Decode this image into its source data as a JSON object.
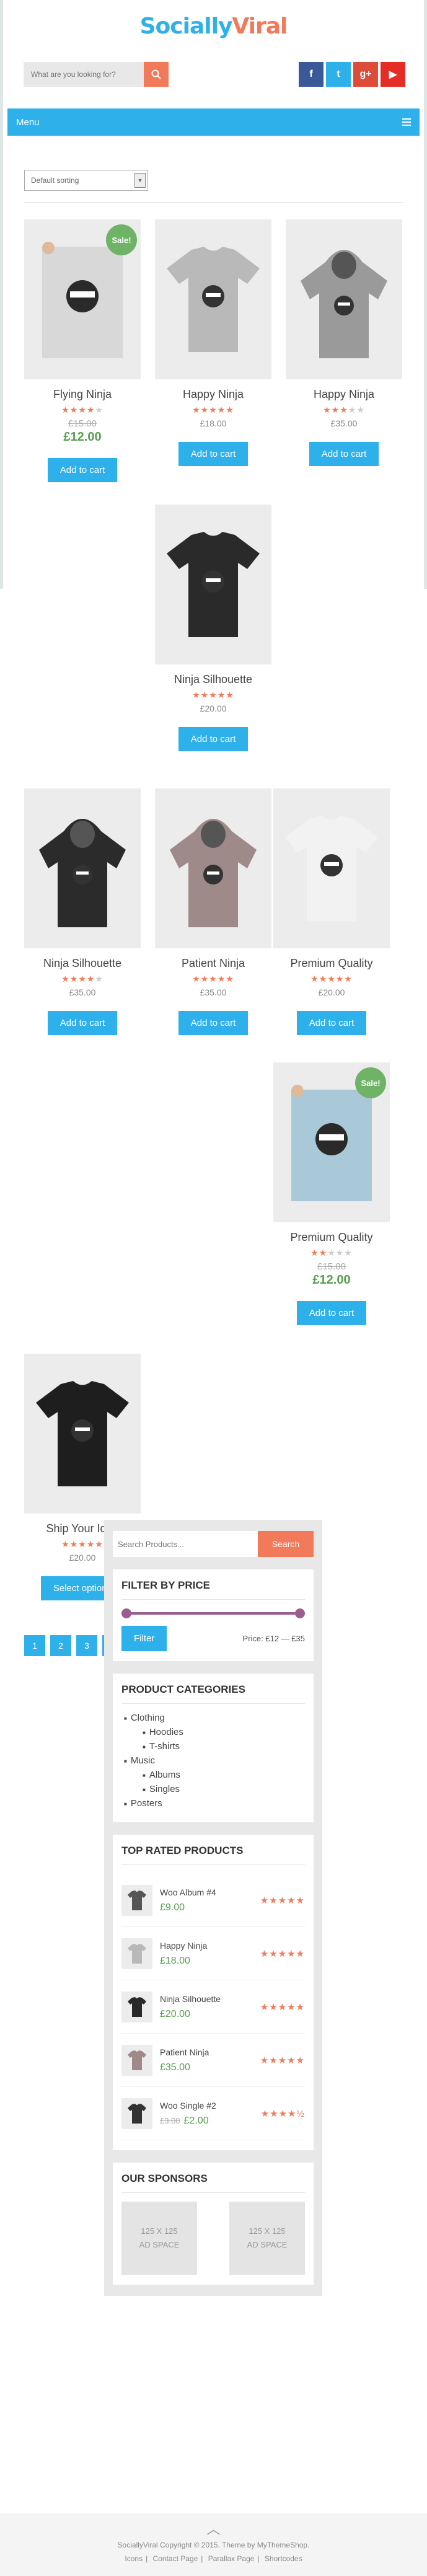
{
  "brand": {
    "part1": "Socially",
    "part2": "Viral"
  },
  "search": {
    "placeholder": "What are you looking for?"
  },
  "social": [
    "f",
    "t",
    "g+",
    "▶"
  ],
  "menu": {
    "label": "Menu"
  },
  "sorting": {
    "selected": "Default sorting"
  },
  "products": [
    {
      "name": "Flying Ninja",
      "rating": 4,
      "price_old": "£15.00",
      "price": "£12.00",
      "sale": "Sale!",
      "button": "Add to cart",
      "thumb": "poster"
    },
    {
      "name": "Happy Ninja",
      "rating": 5,
      "price": "£18.00",
      "button": "Add to cart",
      "thumb": "tshirt-grey"
    },
    {
      "name": "Happy Ninja",
      "rating": 3,
      "price": "£35.00",
      "button": "Add to cart",
      "thumb": "hoodie-grey"
    },
    {
      "name": "Ninja Silhouette",
      "rating": 5,
      "price": "£20.00",
      "button": "Add to cart",
      "thumb": "tshirt-black"
    },
    {
      "name": "Ninja Silhouette",
      "rating": 4,
      "price": "£35.00",
      "button": "Add to cart",
      "thumb": "hoodie-black"
    },
    {
      "name": "Patient Ninja",
      "rating": 5,
      "price": "£35.00",
      "button": "Add to cart",
      "thumb": "hoodie-pink"
    },
    {
      "name": "Premium Quality",
      "rating": 4.5,
      "price": "£20.00",
      "button": "Add to cart",
      "thumb": "tshirt-white"
    },
    {
      "name": "Premium Quality",
      "rating": 2,
      "price_old": "£15.00",
      "price": "£12.00",
      "sale": "Sale!",
      "button": "Add to cart",
      "thumb": "poster-blue"
    },
    {
      "name": "Ship Your Idea",
      "rating": 4.5,
      "price": "£20.00",
      "button": "Select options",
      "thumb": "tshirt-skull"
    }
  ],
  "pagination": [
    "1",
    "2",
    "3",
    "→"
  ],
  "sidebar": {
    "search_placeholder": "Search Products...",
    "search_button": "Search",
    "filter": {
      "title": "FILTER BY PRICE",
      "button": "Filter",
      "range_label": "Price: £12 — £35"
    },
    "categories": {
      "title": "PRODUCT CATEGORIES",
      "items": [
        {
          "label": "Clothing",
          "level": 0
        },
        {
          "label": "Hoodies",
          "level": 1
        },
        {
          "label": "T-shirts",
          "level": 1
        },
        {
          "label": "Music",
          "level": 0
        },
        {
          "label": "Albums",
          "level": 1
        },
        {
          "label": "Singles",
          "level": 1
        },
        {
          "label": "Posters",
          "level": 0
        }
      ]
    },
    "top_rated": {
      "title": "TOP RATED PRODUCTS",
      "items": [
        {
          "name": "Woo Album #4",
          "price": "£9.00",
          "stars": "★★★★★"
        },
        {
          "name": "Happy Ninja",
          "price": "£18.00",
          "stars": "★★★★★"
        },
        {
          "name": "Ninja Silhouette",
          "price": "£20.00",
          "stars": "★★★★★"
        },
        {
          "name": "Patient Ninja",
          "price": "£35.00",
          "stars": "★★★★★"
        },
        {
          "name": "Woo Single #2",
          "price_old": "£3.00",
          "price": "£2.00",
          "stars": "★★★★½"
        }
      ]
    },
    "sponsors": {
      "title": "OUR SPONSORS",
      "ad_size": "125 X 125",
      "ad_label": "AD SPACE"
    }
  },
  "footer": {
    "copyright": "SociallyViral Copyright © 2015. Theme by MyThemeShop.",
    "links": [
      "Icons",
      "Contact Page",
      "Parallax Page",
      "Shortcodes"
    ]
  },
  "colors": {
    "accent": "#2eb1ea",
    "orange": "#f27a5a",
    "sale": "#6fb367",
    "price_green": "#5a9e52",
    "slider": "#9b5c8f"
  }
}
